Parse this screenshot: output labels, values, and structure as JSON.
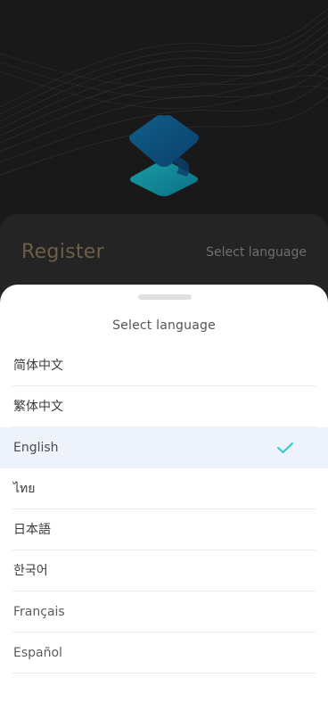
{
  "colors": {
    "accent_check": "#34c9c9",
    "register_title": "#6e5e48",
    "selected_row": "#eef3fb"
  },
  "header": {
    "register_title": "Register",
    "select_language_label": "Select language"
  },
  "sheet": {
    "title": "Select language",
    "languages": [
      {
        "label": "简体中文",
        "selected": false
      },
      {
        "label": "繁体中文",
        "selected": false
      },
      {
        "label": "English",
        "selected": true
      },
      {
        "label": "ไทย",
        "selected": false
      },
      {
        "label": "日本語",
        "selected": false
      },
      {
        "label": "한국어",
        "selected": false
      },
      {
        "label": "Français",
        "selected": false
      },
      {
        "label": "Español",
        "selected": false
      }
    ],
    "selected_icon": "checkmark-icon"
  }
}
